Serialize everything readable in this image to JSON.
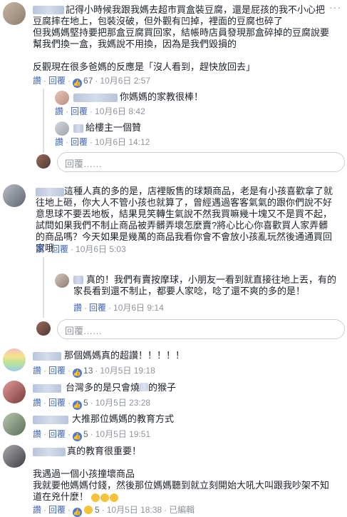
{
  "labels": {
    "like": "讚",
    "reply": "回覆",
    "edited": "已編輯",
    "reply_placeholder": "回覆……",
    "more": "···"
  },
  "comments": [
    {
      "text": "記得小時候我跟我媽去超市買盒裝豆腐，還是屁孩的我不小心把豆腐摔在地上，包裝沒破，但外觀有凹掉，裡面的豆腐也碎了\n但我媽媽堅持要把那盒豆腐買回家，結帳時店員發現那盒碎掉的豆腐說要幫我們換一盒，我媽說不用換，因為是我們毀損的\n\n反觀現在很多爸媽的反應是「沒人看到，趕快放回去」",
      "likes": "67",
      "time": "10月6日 2:57",
      "replies": [
        {
          "text": "你媽媽的家教很棒！",
          "time": "10月6日 8:42"
        },
        {
          "text": "給樓主一個贊",
          "time": "10月6日 14:12"
        }
      ]
    },
    {
      "text": "這種人真的多的是，店裡販售的球類商品，老是有小孩喜歡拿了就往地上砸，你大人不管小孩也就算了，曾經遇過客客氣氣的跟你們說不好意思球不要丟地板，結果見笑轉生氣說不然我買嘛幾十塊又不是買不起，試問如果我們不制止商品被弄髒弄壞怎麼賣?將心比心你喜歡買人家弄髒的商品嗎？今天如果是幾萬的商品我看你會不會放小孩亂玩然後通通買回家哦",
      "time": "10月6日 5:03",
      "replies": [
        {
          "text": "真的！我們有賣按摩球，小朋友一看到就直接往地上丟，有的家長看到還不制止，都要人家唸，唸了還不爽的多的是！",
          "time": "10月6日 9:14"
        }
      ]
    },
    {
      "text": "那個媽媽真的超讚！！！！！",
      "likes": "13",
      "time": "10月5日 19:18"
    },
    {
      "text": "台灣多的是只會燒",
      "text_tail": "的猴子",
      "likes": "5",
      "time": "10月5日 23:28"
    },
    {
      "text": "大推那位媽媽的教育方式",
      "likes": "5",
      "time": "10月5日 19:51"
    },
    {
      "text": "真的教育很重要！\n\n我遇過一個小孩撞壞商品\n我就要他媽媽付錢，然後那位媽媽聽到就立刻開始大吼大叫跟我吵架不知道在兇什麼！",
      "likes": "5",
      "time": "10月5日 18:38"
    }
  ],
  "colors": {
    "link": "#4267b2",
    "like_blue": "#4a76e8",
    "meta_gray": "#90949c"
  }
}
